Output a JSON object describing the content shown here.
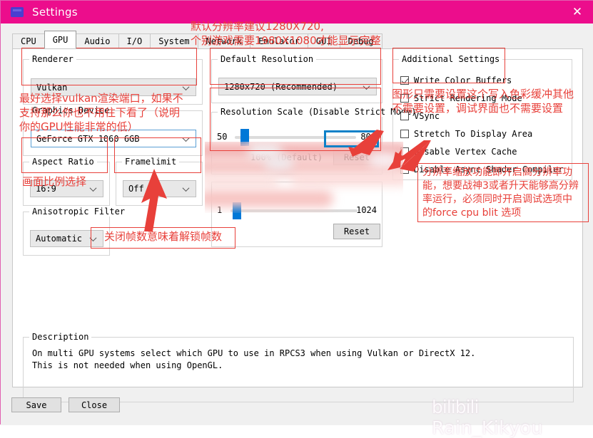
{
  "window": {
    "title": "Settings",
    "titlebar_color": "#ec0d8c",
    "close_icon": "close-icon",
    "app_icon": "settings-app-icon"
  },
  "tabs": [
    {
      "label": "CPU",
      "active": false
    },
    {
      "label": "GPU",
      "active": true
    },
    {
      "label": "Audio",
      "active": false
    },
    {
      "label": "I/O",
      "active": false
    },
    {
      "label": "System",
      "active": false
    },
    {
      "label": "Network",
      "active": false
    },
    {
      "label": "Emulator",
      "active": false
    },
    {
      "label": "GUI",
      "active": false
    },
    {
      "label": "Debug",
      "active": false
    }
  ],
  "gpu": {
    "renderer": {
      "legend": "Renderer",
      "value": "Vulkan"
    },
    "graphics_device": {
      "legend": "Graphics Device",
      "value": "GeForce GTX 1060 6GB"
    },
    "aspect_ratio": {
      "legend": "Aspect Ratio",
      "value": "16:9"
    },
    "framelimit": {
      "legend": "Framelimit",
      "value": "Off"
    },
    "anisotropic_filter": {
      "legend": "Anisotropic Filter",
      "value": "Automatic"
    },
    "default_resolution": {
      "legend": "Default Resolution",
      "value": "1280x720 (Recommended)"
    },
    "resolution_scale": {
      "legend": "Resolution Scale (Disable Strict Mode)",
      "min": "50",
      "max": "800",
      "value_label": "100% (Default)",
      "reset_label": "Reset"
    },
    "redacted_slider": {
      "min": "1",
      "max": "1024",
      "reset_label": "Reset"
    },
    "additional_settings": {
      "legend": "Additional Settings",
      "checkboxes": [
        {
          "label": "Write Color Buffers",
          "checked": true
        },
        {
          "label": "Strict Rendering Mode",
          "checked": false
        },
        {
          "label": "VSync",
          "checked": false
        },
        {
          "label": "Stretch To Display Area",
          "checked": false
        },
        {
          "label": "Disable Vertex Cache",
          "checked": false
        },
        {
          "label": "Disable Async Shader Compiler",
          "checked": false
        }
      ]
    }
  },
  "description": {
    "legend": "Description",
    "text": "On multi GPU systems select which GPU to use in RPCS3 when using Vulkan or DirectX 12.\nThis is not needed when using OpenGL."
  },
  "footer": {
    "save_label": "Save",
    "close_label": "Close"
  },
  "annotations": {
    "accent_color": "#e8403a",
    "top_resolution": "默认分辨率建议1280X720,\n个别游戏需要1980X1080才能显示完整",
    "renderer_note": "最好选择vulkan渲染端口，如果不\n支持那么你也不用往下看了（说明\n你的GPU性能非常的低）",
    "aspect_ratio_note": "画面比例选择",
    "framelimit_note": "关闭帧数意味着解锁帧数",
    "additional_settings_note": "图形只需要设置这个写入色彩缓冲其他\n不需要设置，调试界面也不需要设置",
    "resolution_scale_note": "分辨率缩放功能即开启高分辨率功\n能，想要战神3或者升天能够高分辨\n率运行，必须同时开启调试选项中\n的force cpu blit 选项"
  },
  "watermark": {
    "brand": "bilibili",
    "user": "Rain_Kikyou"
  }
}
